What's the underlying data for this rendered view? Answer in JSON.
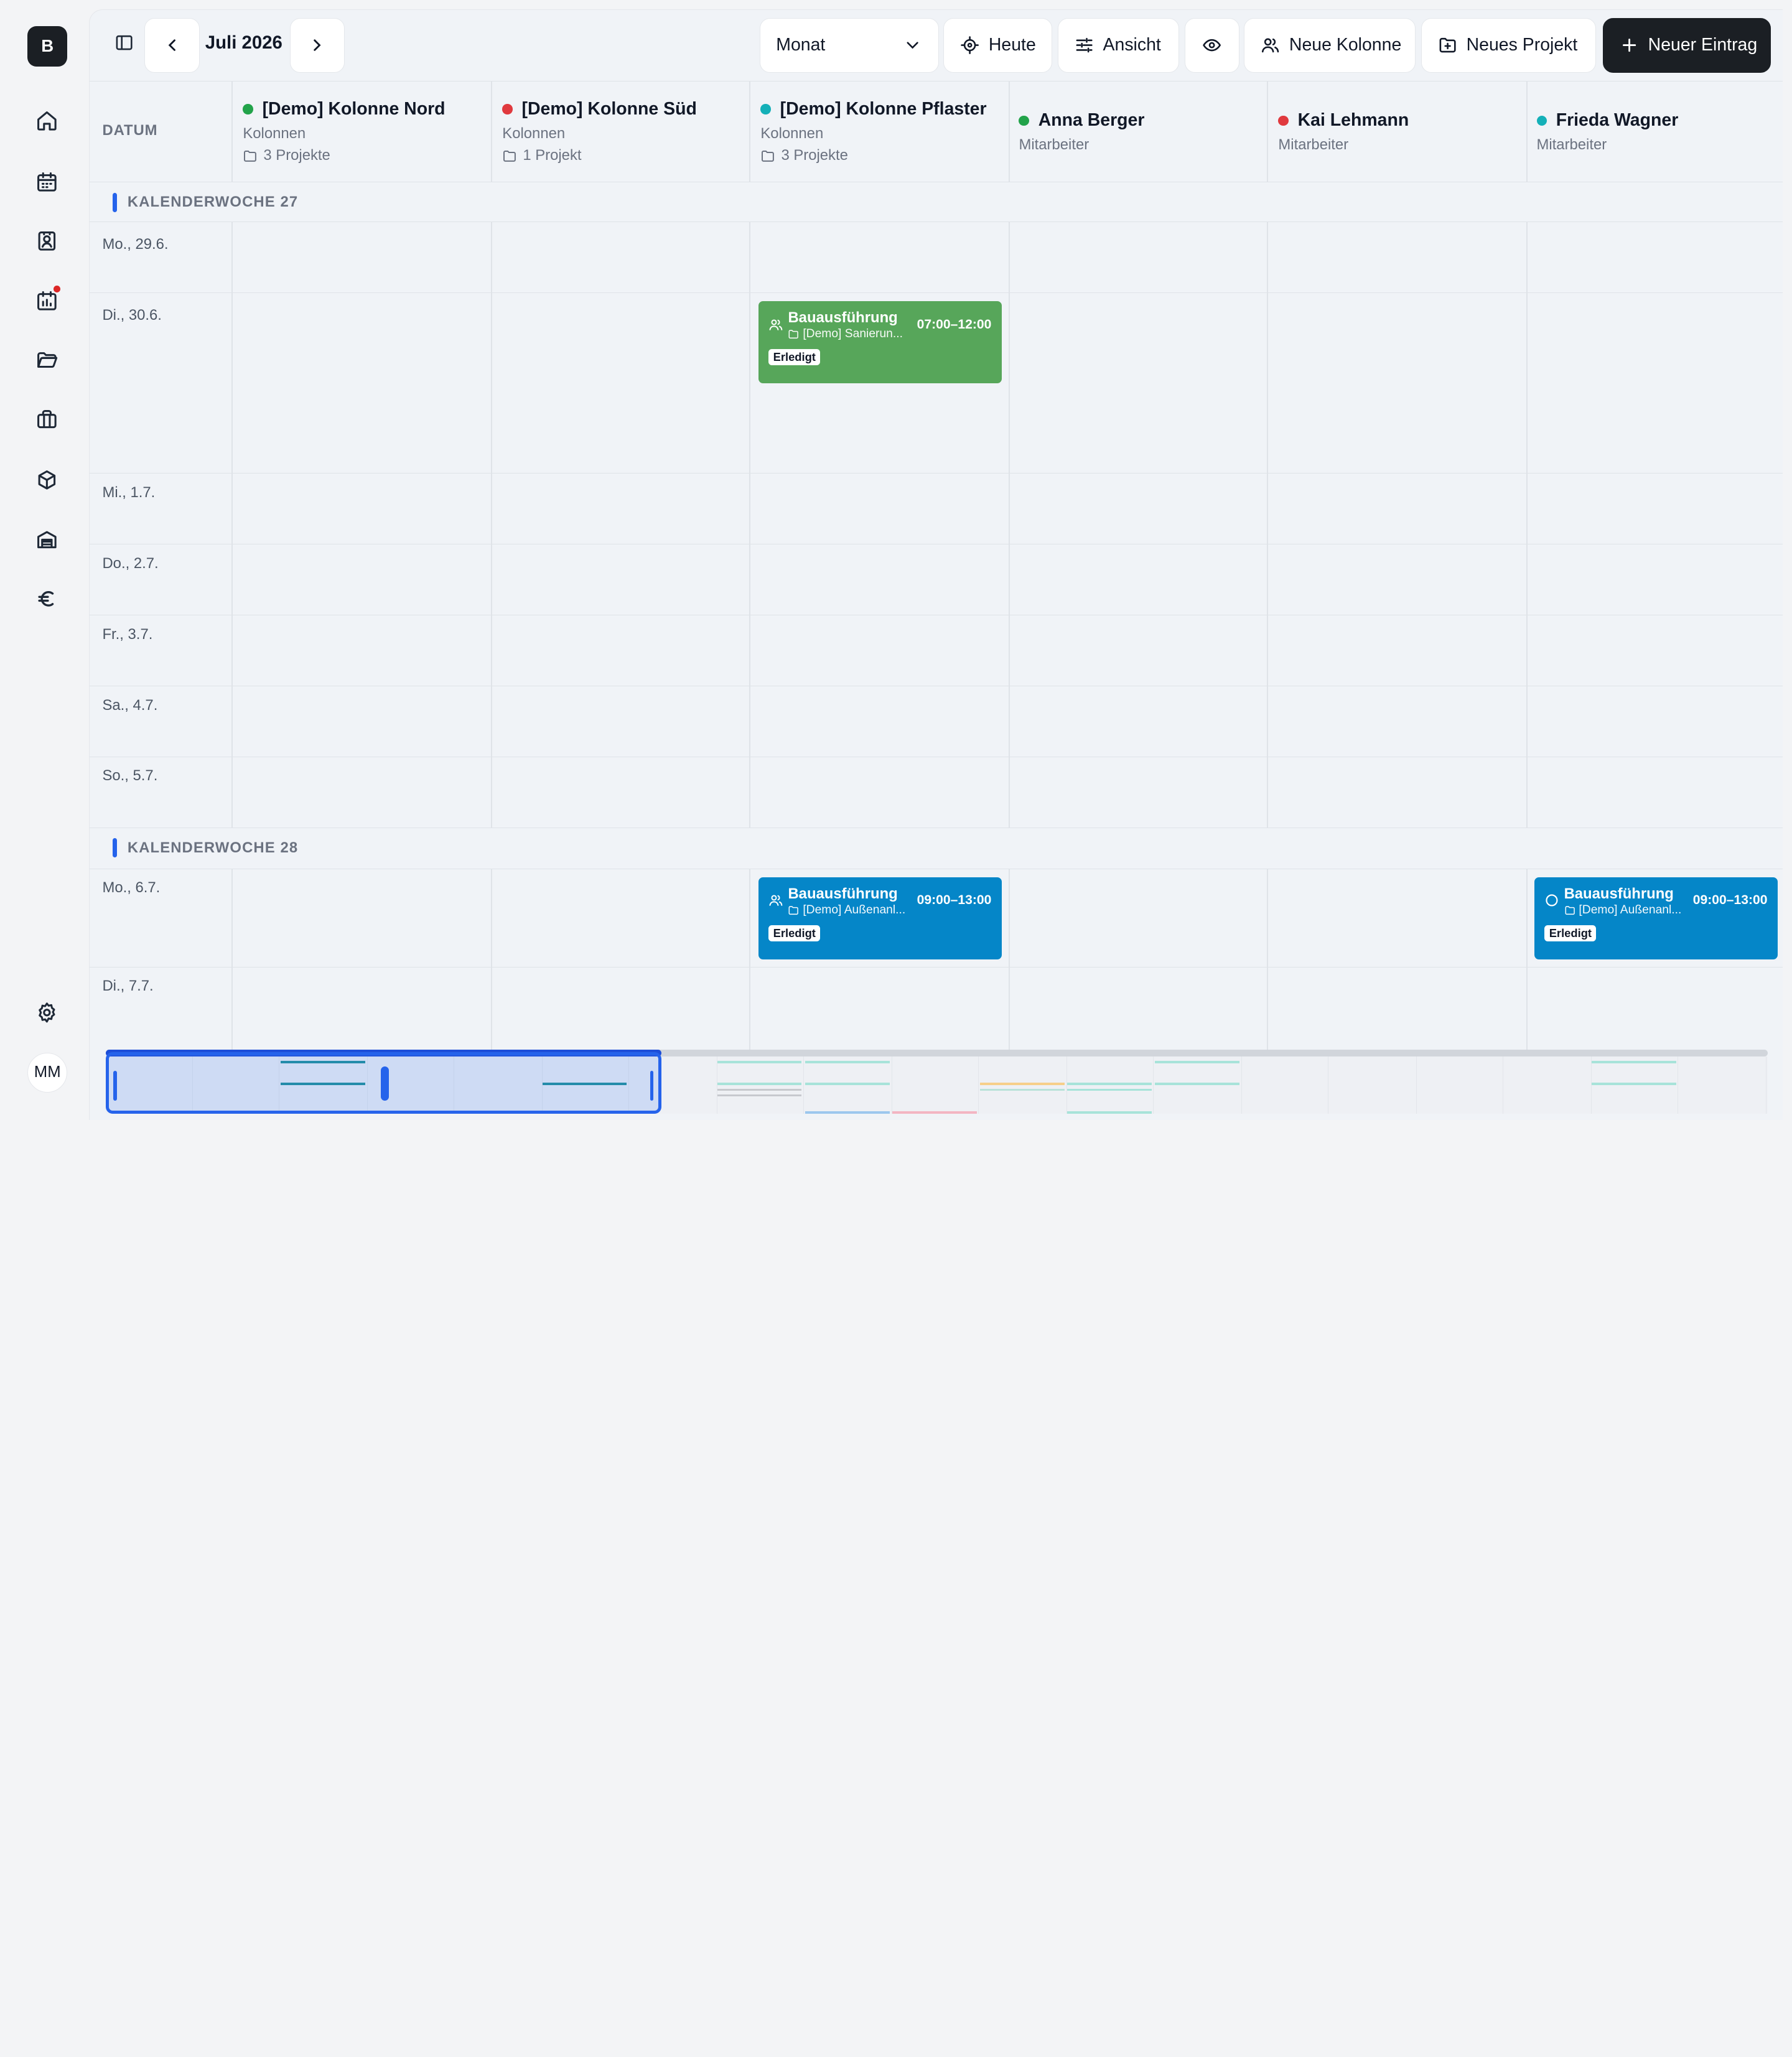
{
  "sidebar": {
    "logo": "B",
    "nav": [
      {
        "name": "home-icon"
      },
      {
        "name": "calendar-icon"
      },
      {
        "name": "contacts-icon"
      },
      {
        "name": "reports-icon",
        "badge": true
      },
      {
        "name": "folder-icon"
      },
      {
        "name": "briefcase-icon"
      },
      {
        "name": "package-icon"
      },
      {
        "name": "warehouse-icon"
      },
      {
        "name": "euro-icon"
      }
    ],
    "settings_icon": "gear-icon",
    "avatar": "MM"
  },
  "toolbar": {
    "month": "Juli 2026",
    "view_select": "Monat",
    "today": "Heute",
    "view": "Ansicht",
    "new_column": "Neue Kolonne",
    "new_project": "Neues Projekt",
    "new_entry": "Neuer Eintrag"
  },
  "grid": {
    "date_header": "DATUM",
    "columns": [
      {
        "name": "[Demo] Kolonne Nord",
        "type": "Kolonnen",
        "projects": "3 Projekte",
        "color": "#22a34a"
      },
      {
        "name": "[Demo] Kolonne Süd",
        "type": "Kolonnen",
        "projects": "1 Projekt",
        "color": "#e0393e"
      },
      {
        "name": "[Demo] Kolonne Pflaster",
        "type": "Kolonnen",
        "projects": "3 Projekte",
        "color": "#14b0b8"
      },
      {
        "name": "Anna Berger",
        "type": "Mitarbeiter",
        "color": "#22a34a"
      },
      {
        "name": "Kai Lehmann",
        "type": "Mitarbeiter",
        "color": "#e0393e"
      },
      {
        "name": "Frieda Wagner",
        "type": "Mitarbeiter",
        "color": "#14b0b8"
      }
    ],
    "weeks": [
      {
        "label": "KALENDERWOCHE 27",
        "days": [
          "Mo., 29.6.",
          "Di., 30.6.",
          "Mi., 1.7.",
          "Do., 2.7.",
          "Fr., 3.7.",
          "Sa., 4.7.",
          "So., 5.7."
        ]
      },
      {
        "label": "KALENDERWOCHE 28",
        "days": [
          "Mo., 6.7.",
          "Di., 7.7."
        ]
      }
    ]
  },
  "events": [
    {
      "title": "Bauausführung",
      "project": "[Demo] Sanierun...",
      "time": "07:00–12:00",
      "status": "Erledigt",
      "color": "#57a65a",
      "icon": "users-icon"
    },
    {
      "title": "Bauausführung",
      "project": "[Demo] Außenanl...",
      "time": "09:00–13:00",
      "status": "Erledigt",
      "color": "#0586c8",
      "icon": "users-icon"
    },
    {
      "title": "Bauausführung",
      "project": "[Demo] Außenanl...",
      "time": "09:00–13:00",
      "status": "Erledigt",
      "color": "#0586c8",
      "icon": "circle-icon"
    }
  ]
}
